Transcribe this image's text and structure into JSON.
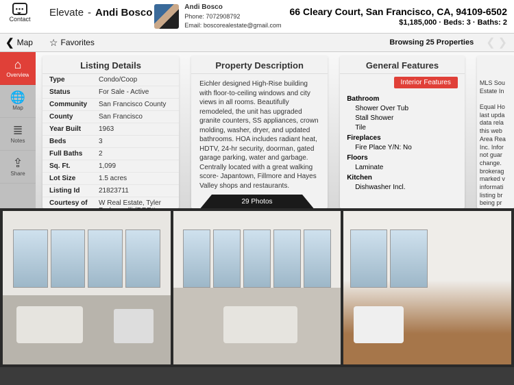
{
  "header": {
    "contact_label": "Contact",
    "brand": "Elevate",
    "dash": "-",
    "agent_display": "Andi Bosco",
    "agent": {
      "name": "Andi Bosco",
      "phone_label": "Phone:",
      "phone": "7072908792",
      "email_label": "Email:",
      "email": "boscorealestate@gmail.com"
    },
    "address": "66 Cleary Court, San Francisco, CA, 94109-6502",
    "stats": "$1,185,000 · Beds: 3 · Baths: 2"
  },
  "subheader": {
    "back_label": "Map",
    "favorites_label": "Favorites",
    "browsing": "Browsing 25 Properties"
  },
  "sidebar": {
    "items": [
      {
        "label": "Overview"
      },
      {
        "label": "Map"
      },
      {
        "label": "Notes"
      },
      {
        "label": "Share"
      }
    ]
  },
  "cards": {
    "listing": {
      "title": "Listing Details",
      "rows": [
        {
          "k": "Type",
          "v": "Condo/Coop"
        },
        {
          "k": "Status",
          "v": "For Sale - Active"
        },
        {
          "k": "Community",
          "v": "San Francisco County"
        },
        {
          "k": "County",
          "v": "San Francisco"
        },
        {
          "k": "Year Built",
          "v": "1963"
        },
        {
          "k": "Beds",
          "v": "3"
        },
        {
          "k": "Full Baths",
          "v": "2"
        },
        {
          "k": "Sq. Ft.",
          "v": "1,099"
        },
        {
          "k": "Lot Size",
          "v": "1.5 acres"
        },
        {
          "k": "Listing Id",
          "v": "21823711"
        },
        {
          "k": "Courtesy of",
          "v": "W Real Estate, Tyler Pedroncelli (DRE#"
        }
      ]
    },
    "description": {
      "title": "Property Description",
      "text": "Eichler designed High-Rise building with floor-to-ceiling windows and city views in all rooms. Beautifully remodeled, the unit has upgraded granite counters, SS appliances, crown molding, washer, dryer, and updated bathrooms. HOA includes radiant heat, HDTV, 24-hr security, doorman, gated garage parking, water and garbage. Centrally located with a great walking score- Japantown, Fillmore and Hayes Valley shops and restaurants."
    },
    "features": {
      "title": "General Features",
      "badge": "Interior Features",
      "sections": [
        {
          "h": "Bathroom",
          "items": [
            "Shower Over Tub",
            "Stall Shower",
            "Tile"
          ]
        },
        {
          "h": "Fireplaces",
          "items": [
            "Fire Place Y/N: No"
          ]
        },
        {
          "h": "Floors",
          "items": [
            "Laminate"
          ]
        },
        {
          "h": "Kitchen",
          "items": [
            "Dishwasher Incl."
          ]
        }
      ]
    },
    "disclaimer": {
      "text": "MLS Sou Estate In\n\nEqual Ho last upda data rela this web Area Rea Inc. Infor not guar change. brokerag marked v informati listing br being pr"
    }
  },
  "photos": {
    "tab": "29 Photos"
  }
}
